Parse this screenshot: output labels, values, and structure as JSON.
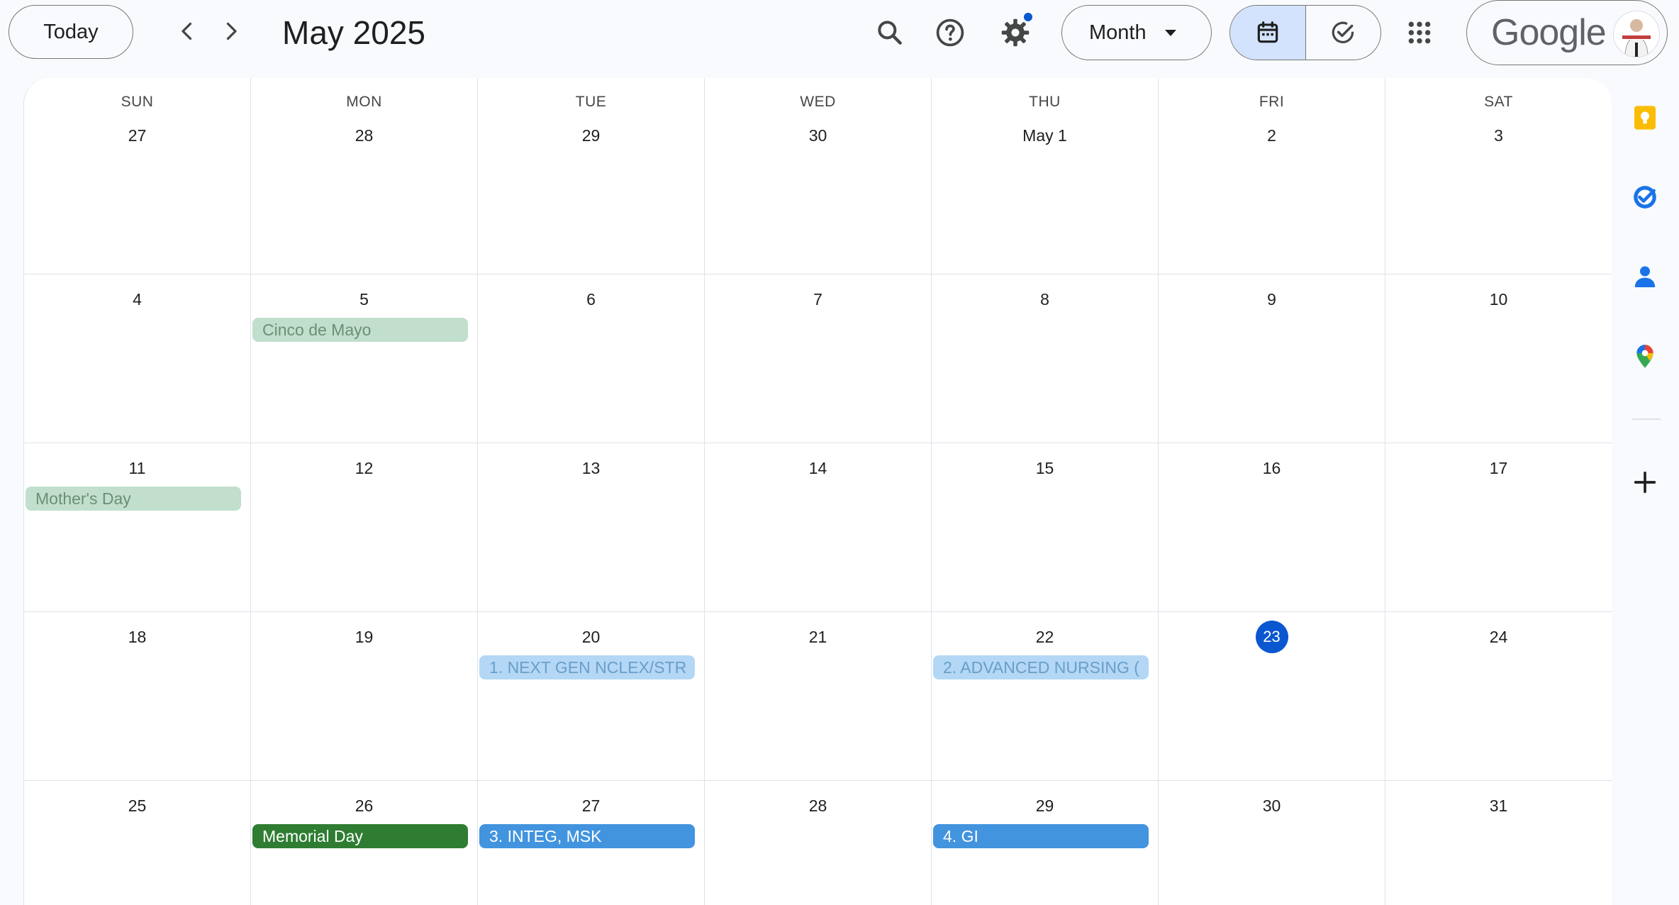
{
  "toolbar": {
    "today_label": "Today",
    "title": "May 2025",
    "view_label": "Month",
    "brand": "Google"
  },
  "weekdays": [
    "SUN",
    "MON",
    "TUE",
    "WED",
    "THU",
    "FRI",
    "SAT"
  ],
  "weeks": [
    [
      "27",
      "28",
      "29",
      "30",
      "May 1",
      "2",
      "3"
    ],
    [
      "4",
      "5",
      "6",
      "7",
      "8",
      "9",
      "10"
    ],
    [
      "11",
      "12",
      "13",
      "14",
      "15",
      "16",
      "17"
    ],
    [
      "18",
      "19",
      "20",
      "21",
      "22",
      "23",
      "24"
    ],
    [
      "25",
      "26",
      "27",
      "28",
      "29",
      "30",
      "31"
    ]
  ],
  "today_date": "23",
  "events": {
    "cinco": "Cinco de Mayo",
    "mothers": "Mother's Day",
    "nclex": "1. NEXT GEN NCLEX/STR",
    "advanced": "2. ADVANCED NURSING (",
    "memorial": "Memorial Day",
    "integ": "3. INTEG, MSK",
    "gi": "4. GI"
  },
  "colors": {
    "accent": "#0b57d0",
    "toggle_active": "#d3e3fd",
    "holiday_light": "#c2dfcd",
    "holiday_dark": "#2e7d32",
    "event_light_blue": "#b3d7f5",
    "event_blue": "#4294de"
  },
  "icons": {
    "search": "search-icon",
    "help": "help-icon",
    "settings": "gear-icon",
    "calendar": "calendar-icon",
    "tasks": "check-circle-icon",
    "apps": "apps-grid-icon",
    "keep": "keep-icon",
    "tasks_side": "tasks-icon",
    "contacts": "contacts-icon",
    "maps": "maps-icon",
    "add": "plus-icon"
  }
}
